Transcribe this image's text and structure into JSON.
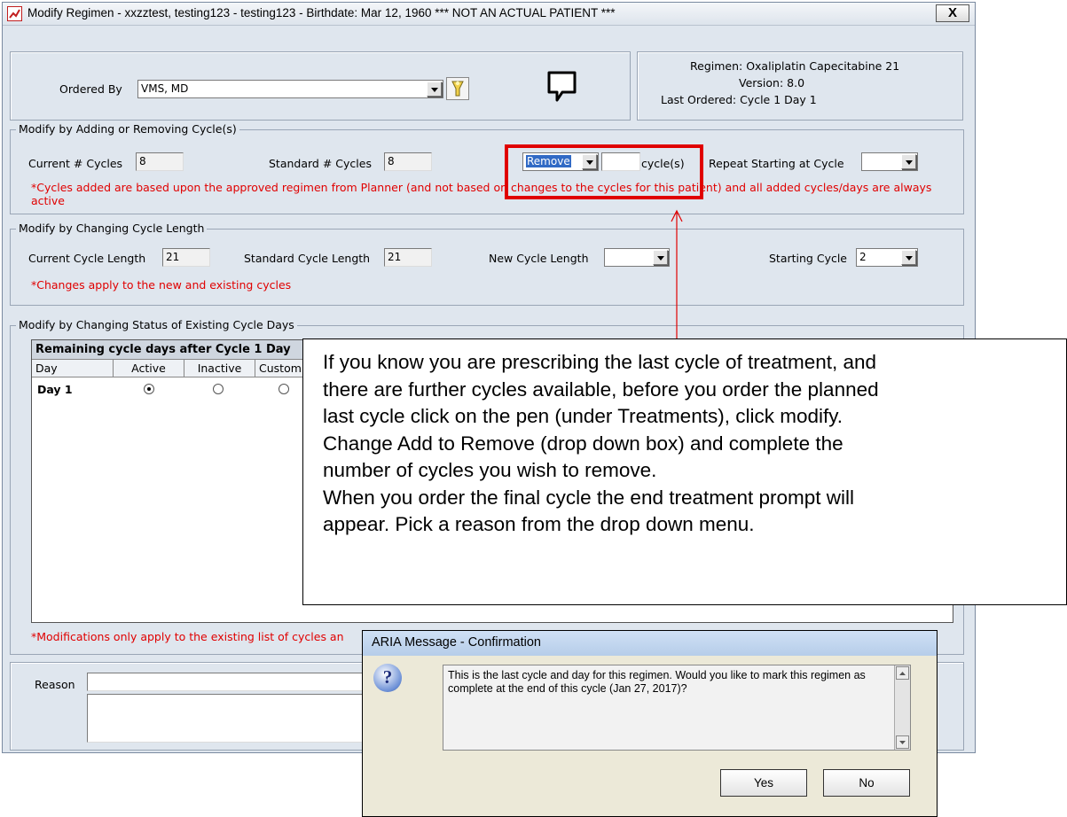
{
  "window": {
    "title": "Modify Regimen - xxzztest, testing123  - testing123 - Birthdate: Mar 12, 1960 *** NOT AN ACTUAL PATIENT ***",
    "close_label": "X"
  },
  "ordered_by": {
    "label": "Ordered By",
    "value": "VMS, MD"
  },
  "regimen_info": {
    "regimen": "Regimen: Oxaliplatin Capecitabine 21",
    "version": "Version: 8.0",
    "last_ordered": "Last Ordered: Cycle 1 Day 1"
  },
  "cycles_group": {
    "title": "Modify by Adding or Removing Cycle(s)",
    "current_label": "Current # Cycles",
    "current_value": "8",
    "standard_label": "Standard # Cycles",
    "standard_value": "8",
    "action_value": "Remove",
    "cycle_suffix": "cycle(s)",
    "repeat_label": "Repeat Starting at Cycle",
    "note": "*Cycles added are based upon the approved regimen from Planner (and not based on changes to the cycles for this patient) and all added cycles/days are always active"
  },
  "length_group": {
    "title": "Modify by Changing Cycle Length",
    "current_label": "Current Cycle Length",
    "current_value": "21",
    "standard_label": "Standard Cycle Length",
    "standard_value": "21",
    "new_label": "New Cycle Length",
    "starting_label": "Starting Cycle",
    "starting_value": "2",
    "note": "*Changes apply to the new and existing cycles"
  },
  "status_group": {
    "title": "Modify by Changing Status of Existing Cycle Days",
    "grid_header": "Remaining cycle days after Cycle 1 Day",
    "columns": [
      "Day",
      "Active",
      "Inactive",
      "Custom"
    ],
    "rows": [
      {
        "day": "Day 1"
      }
    ],
    "note": "*Modifications only apply to the existing list of cycles an"
  },
  "reason": {
    "label": "Reason"
  },
  "callout": {
    "lines": [
      "If you know you are prescribing the last cycle of treatment, and",
      "there are further cycles available, before you order the planned",
      "last cycle click on the pen (under Treatments), click modify.",
      "Change Add to Remove (drop down box) and complete the",
      "number of cycles you wish to remove.",
      "When you order the final cycle the end treatment prompt will",
      "appear. Pick a reason from the drop down menu."
    ]
  },
  "dialog": {
    "title": "ARIA Message - Confirmation",
    "icon": "question-icon",
    "message": "This is the last cycle and day for this regimen. Would you like to mark this regimen as complete at the end of this cycle (Jan 27, 2017)?",
    "yes_label": "Yes",
    "no_label": "No"
  },
  "colors": {
    "highlight": "#e00000",
    "note_text": "#e00000",
    "window_bg": "#dfe6ee"
  }
}
